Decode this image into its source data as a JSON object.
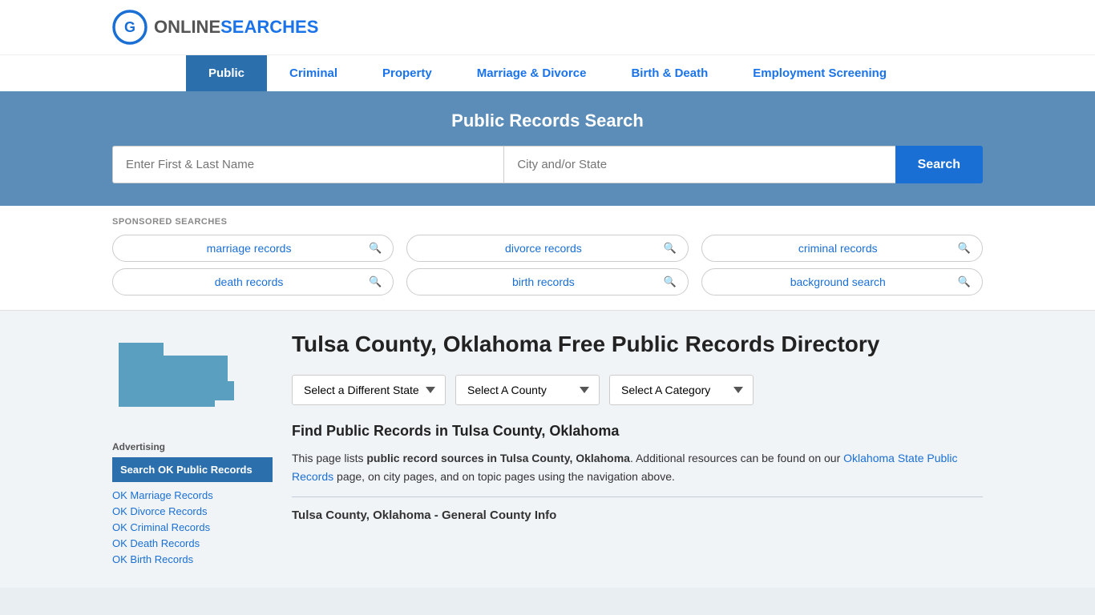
{
  "header": {
    "logo": {
      "online": "ONLINE",
      "searches": "SEARCHES"
    }
  },
  "nav": {
    "items": [
      {
        "id": "public",
        "label": "Public",
        "active": true
      },
      {
        "id": "criminal",
        "label": "Criminal",
        "active": false
      },
      {
        "id": "property",
        "label": "Property",
        "active": false
      },
      {
        "id": "marriage-divorce",
        "label": "Marriage & Divorce",
        "active": false
      },
      {
        "id": "birth-death",
        "label": "Birth & Death",
        "active": false
      },
      {
        "id": "employment",
        "label": "Employment Screening",
        "active": false
      }
    ]
  },
  "searchBanner": {
    "title": "Public Records Search",
    "namePlaceholder": "Enter First & Last Name",
    "cityPlaceholder": "City and/or State",
    "searchButton": "Search"
  },
  "sponsored": {
    "label": "SPONSORED SEARCHES",
    "items": [
      "marriage records",
      "divorce records",
      "criminal records",
      "death records",
      "birth records",
      "background search"
    ]
  },
  "page": {
    "title": "Tulsa County, Oklahoma Free Public Records Directory",
    "dropdowns": {
      "state": "Select a Different State",
      "county": "Select A County",
      "category": "Select A Category"
    },
    "findTitle": "Find Public Records in Tulsa County, Oklahoma",
    "findText1": "This page lists ",
    "findBold1": "public record sources in Tulsa County, Oklahoma",
    "findText2": ". Additional resources can be found on our ",
    "findLink": "Oklahoma State Public Records",
    "findText3": " page, on city pages, and on topic pages using the navigation above.",
    "countyInfoTitle": "Tulsa County, Oklahoma - General County Info"
  },
  "sidebar": {
    "advertisingLabel": "Advertising",
    "adPrimary": "Search OK Public Records",
    "links": [
      "OK Marriage Records",
      "OK Divorce Records",
      "OK Criminal Records",
      "OK Death Records",
      "OK Birth Records"
    ]
  }
}
